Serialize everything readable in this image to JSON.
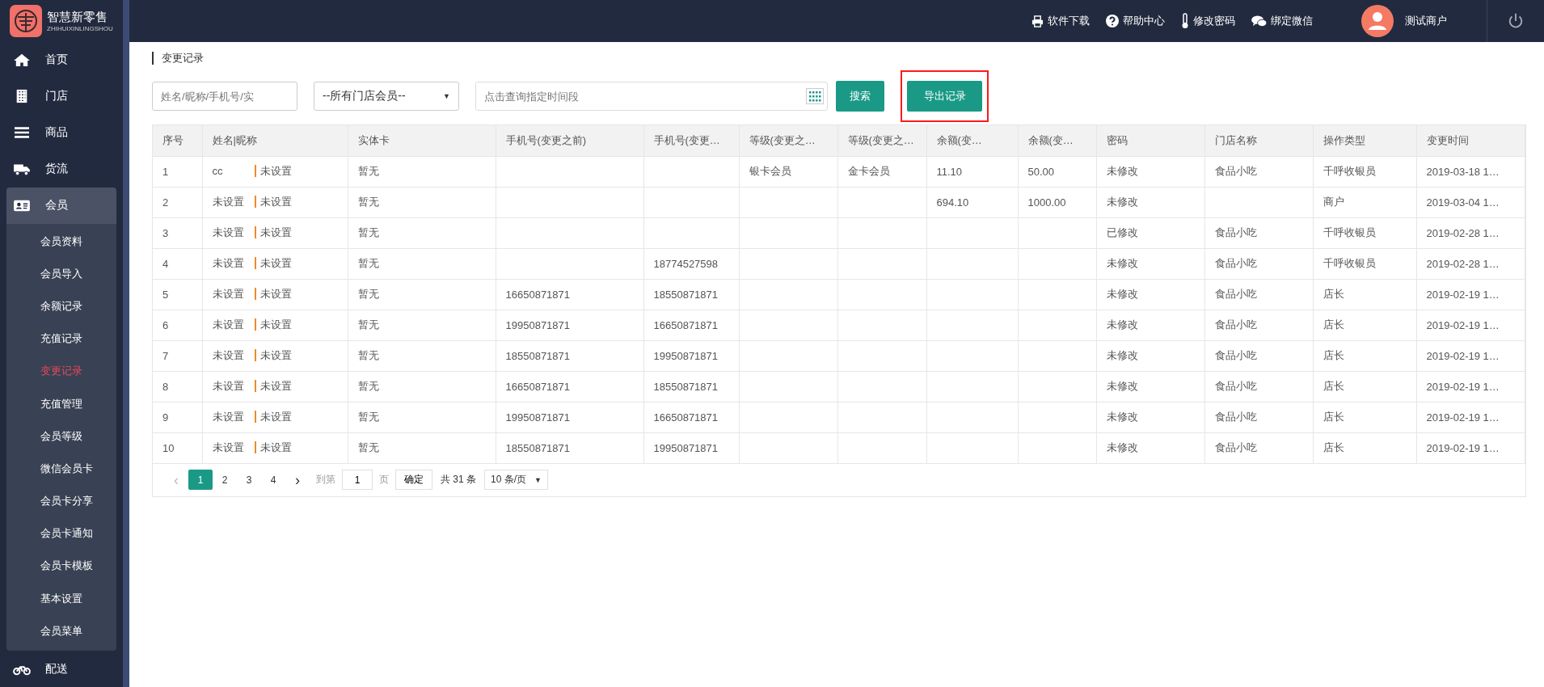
{
  "logo": {
    "title": "智慧新零售",
    "subtitle": "ZHIHUIXINLINGSHOU"
  },
  "sidebar": {
    "items": [
      {
        "label": "首页",
        "expanded": false
      },
      {
        "label": "门店",
        "expanded": false
      },
      {
        "label": "商品",
        "expanded": false
      },
      {
        "label": "货流",
        "expanded": false
      },
      {
        "label": "会员",
        "expanded": true,
        "children": [
          {
            "label": "会员资料",
            "selected": false
          },
          {
            "label": "会员导入",
            "selected": false
          },
          {
            "label": "余额记录",
            "selected": false
          },
          {
            "label": "充值记录",
            "selected": false
          },
          {
            "label": "变更记录",
            "selected": true
          },
          {
            "label": "充值管理",
            "selected": false
          },
          {
            "label": "会员等级",
            "selected": false
          },
          {
            "label": "微信会员卡",
            "selected": false
          },
          {
            "label": "会员卡分享",
            "selected": false
          },
          {
            "label": "会员卡通知",
            "selected": false
          },
          {
            "label": "会员卡模板",
            "selected": false
          },
          {
            "label": "基本设置",
            "selected": false
          },
          {
            "label": "会员菜单",
            "selected": false
          }
        ]
      },
      {
        "label": "配送",
        "expanded": false
      }
    ]
  },
  "topbar": {
    "links": [
      {
        "label": "软件下载"
      },
      {
        "label": "帮助中心"
      },
      {
        "label": "修改密码"
      },
      {
        "label": "绑定微信"
      }
    ],
    "user": "测试商户"
  },
  "page_title": "变更记录",
  "filters": {
    "search_placeholder": "姓名/昵称/手机号/实",
    "store_select": "--所有门店会员--",
    "store_select_caret": "▼",
    "date_placeholder": "点击查询指定时间段",
    "search_button": "搜索",
    "export_button": "导出记录",
    "export_highlighted": true
  },
  "table": {
    "columns": [
      "序号",
      "姓名|昵称",
      "实体卡",
      "手机号(变更之前)",
      "手机号(变更…",
      "等级(变更之…",
      "等级(变更之…",
      "余额(变…",
      "余额(变…",
      "密码",
      "门店名称",
      "操作类型",
      "变更时间"
    ],
    "rows": [
      {
        "no": "1",
        "name": "cc",
        "nickname": "未设置",
        "card": "暂无",
        "phone_before": "",
        "phone_after": "",
        "level_before": "银卡会员",
        "level_after": "金卡会员",
        "balance_before": "11.10",
        "balance_after": "50.00",
        "password": "未修改",
        "store": "食品小吃",
        "operator": "千呼收银员",
        "time": "2019-03-18 1…"
      },
      {
        "no": "2",
        "name": "未设置",
        "nickname": "未设置",
        "card": "暂无",
        "phone_before": "",
        "phone_after": "",
        "level_before": "",
        "level_after": "",
        "balance_before": "694.10",
        "balance_after": "1000.00",
        "password": "未修改",
        "store": "",
        "operator": "商户",
        "time": "2019-03-04 1…"
      },
      {
        "no": "3",
        "name": "未设置",
        "nickname": "未设置",
        "card": "暂无",
        "phone_before": "",
        "phone_after": "",
        "level_before": "",
        "level_after": "",
        "balance_before": "",
        "balance_after": "",
        "password": "已修改",
        "store": "食品小吃",
        "operator": "千呼收银员",
        "time": "2019-02-28 1…"
      },
      {
        "no": "4",
        "name": "未设置",
        "nickname": "未设置",
        "card": "暂无",
        "phone_before": "",
        "phone_after": "18774527598",
        "level_before": "",
        "level_after": "",
        "balance_before": "",
        "balance_after": "",
        "password": "未修改",
        "store": "食品小吃",
        "operator": "千呼收银员",
        "time": "2019-02-28 1…"
      },
      {
        "no": "5",
        "name": "未设置",
        "nickname": "未设置",
        "card": "暂无",
        "phone_before": "16650871871",
        "phone_after": "18550871871",
        "level_before": "",
        "level_after": "",
        "balance_before": "",
        "balance_after": "",
        "password": "未修改",
        "store": "食品小吃",
        "operator": "店长",
        "time": "2019-02-19 1…"
      },
      {
        "no": "6",
        "name": "未设置",
        "nickname": "未设置",
        "card": "暂无",
        "phone_before": "19950871871",
        "phone_after": "16650871871",
        "level_before": "",
        "level_after": "",
        "balance_before": "",
        "balance_after": "",
        "password": "未修改",
        "store": "食品小吃",
        "operator": "店长",
        "time": "2019-02-19 1…"
      },
      {
        "no": "7",
        "name": "未设置",
        "nickname": "未设置",
        "card": "暂无",
        "phone_before": "18550871871",
        "phone_after": "19950871871",
        "level_before": "",
        "level_after": "",
        "balance_before": "",
        "balance_after": "",
        "password": "未修改",
        "store": "食品小吃",
        "operator": "店长",
        "time": "2019-02-19 1…"
      },
      {
        "no": "8",
        "name": "未设置",
        "nickname": "未设置",
        "card": "暂无",
        "phone_before": "16650871871",
        "phone_after": "18550871871",
        "level_before": "",
        "level_after": "",
        "balance_before": "",
        "balance_after": "",
        "password": "未修改",
        "store": "食品小吃",
        "operator": "店长",
        "time": "2019-02-19 1…"
      },
      {
        "no": "9",
        "name": "未设置",
        "nickname": "未设置",
        "card": "暂无",
        "phone_before": "19950871871",
        "phone_after": "16650871871",
        "level_before": "",
        "level_after": "",
        "balance_before": "",
        "balance_after": "",
        "password": "未修改",
        "store": "食品小吃",
        "operator": "店长",
        "time": "2019-02-19 1…"
      },
      {
        "no": "10",
        "name": "未设置",
        "nickname": "未设置",
        "card": "暂无",
        "phone_before": "18550871871",
        "phone_after": "19950871871",
        "level_before": "",
        "level_after": "",
        "balance_before": "",
        "balance_after": "",
        "password": "未修改",
        "store": "食品小吃",
        "operator": "店长",
        "time": "2019-02-19 1…"
      }
    ]
  },
  "pagination": {
    "prev": "‹",
    "pages": [
      {
        "label": "1",
        "selected": true
      },
      {
        "label": "2",
        "selected": false
      },
      {
        "label": "3",
        "selected": false
      },
      {
        "label": "4",
        "selected": false
      }
    ],
    "next": "›",
    "goto_label": "到第",
    "goto_value": "1",
    "page_unit": "页",
    "confirm": "确定",
    "total": "共 31 条",
    "page_size": "10 条/页",
    "page_size_caret": "▼"
  }
}
